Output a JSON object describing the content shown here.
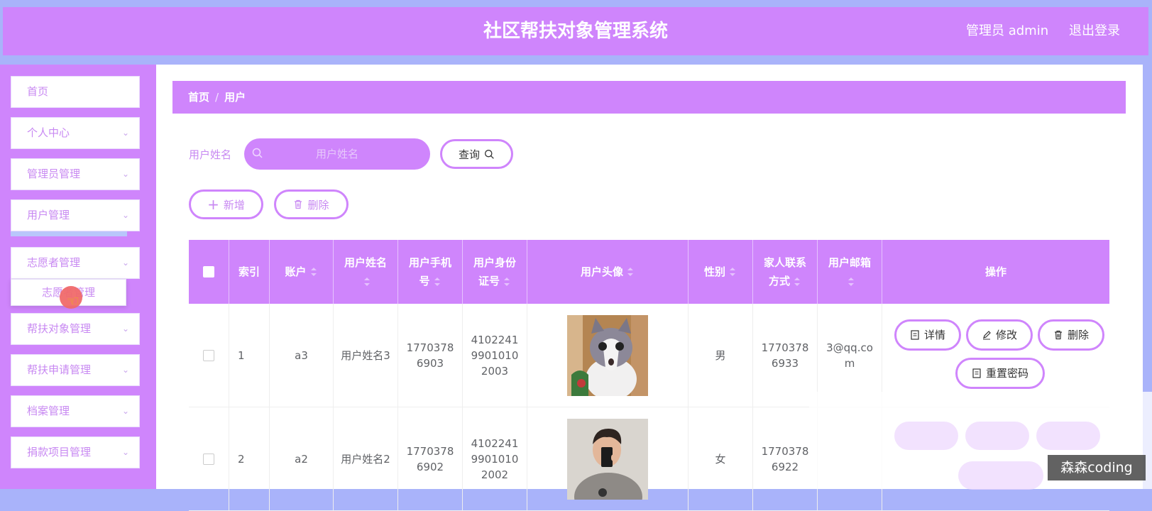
{
  "header": {
    "title": "社区帮扶对象管理系统",
    "admin_label": "管理员 admin",
    "logout_label": "退出登录"
  },
  "sidebar": {
    "items": [
      {
        "label": "首页",
        "has_chevron": false
      },
      {
        "label": "个人中心",
        "has_chevron": true
      },
      {
        "label": "管理员管理",
        "has_chevron": true
      },
      {
        "label": "用户管理",
        "has_chevron": true
      },
      {
        "label": "志愿者管理",
        "has_chevron": true
      },
      {
        "label": "帮扶对象管理",
        "has_chevron": true
      },
      {
        "label": "帮扶申请管理",
        "has_chevron": true
      },
      {
        "label": "档案管理",
        "has_chevron": true
      },
      {
        "label": "捐款项目管理",
        "has_chevron": true
      }
    ],
    "submenu_label": "志愿者管理"
  },
  "breadcrumb": {
    "home": "首页",
    "separator": "/",
    "current": "用户"
  },
  "search": {
    "label": "用户姓名",
    "placeholder": "用户姓名",
    "query_label": "查询"
  },
  "toolbar": {
    "add_label": "新增",
    "delete_label": "删除"
  },
  "table": {
    "columns": [
      {
        "label": "",
        "sortable": false
      },
      {
        "label": "索引",
        "sortable": false
      },
      {
        "label": "账户",
        "sortable": true
      },
      {
        "label": "用户姓名",
        "sortable": true
      },
      {
        "label": "用户手机号",
        "sortable": true
      },
      {
        "label": "用户身份证号",
        "sortable": true
      },
      {
        "label": "用户头像",
        "sortable": true
      },
      {
        "label": "性别",
        "sortable": true
      },
      {
        "label": "家人联系方式",
        "sortable": true
      },
      {
        "label": "用户邮箱",
        "sortable": true
      },
      {
        "label": "操作",
        "sortable": false
      }
    ],
    "rows": [
      {
        "index": "1",
        "account": "a3",
        "name": "用户姓名3",
        "phone": "17703786903",
        "id_card": "410224199010102003",
        "avatar": "cat-photo",
        "gender": "男",
        "family_phone": "17703786933",
        "email": "3@qq.com"
      },
      {
        "index": "2",
        "account": "a2",
        "name": "用户姓名2",
        "phone": "17703786902",
        "id_card": "410224199010102002",
        "avatar": "person-photo",
        "gender": "女",
        "family_phone": "17703786922",
        "email": ""
      }
    ],
    "actions": {
      "detail": "详情",
      "edit": "修改",
      "delete": "删除",
      "reset_password": "重置密码"
    }
  },
  "watermark": "森森coding",
  "colors": {
    "primary": "#cf85fc",
    "page_background": "#a9b3fa",
    "menu_text": "#c889f2"
  }
}
